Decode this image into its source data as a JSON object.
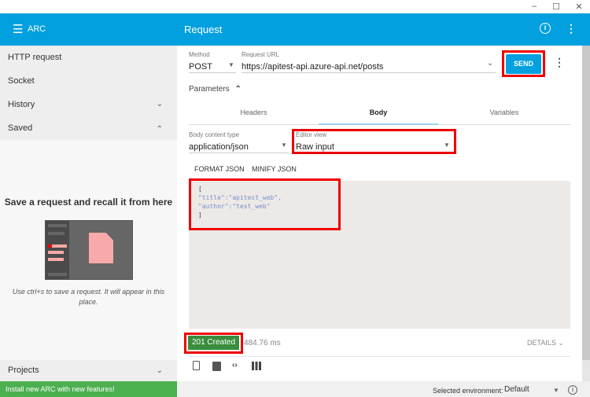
{
  "window": {
    "minimize": "–",
    "maximize": "☐",
    "close": "✕"
  },
  "header": {
    "app_name": "ARC",
    "title": "Request",
    "menu_icon": "hamburger-icon",
    "info_icon": "info-icon",
    "more_icon": "more-vert-icon"
  },
  "sidebar": {
    "items": [
      {
        "label": "HTTP request"
      },
      {
        "label": "Socket"
      },
      {
        "label": "History"
      },
      {
        "label": "Saved"
      }
    ],
    "empty_title": "Save a request and recall it from here",
    "empty_hint": "Use ctrl+s to save a request. It will appear in this place.",
    "projects": "Projects",
    "install_banner": "Install new ARC with new features!"
  },
  "request": {
    "method_label": "Method",
    "method": "POST",
    "url_label": "Request URL",
    "url": "https://apitest-api.azure-api.net/posts",
    "send": "SEND",
    "parameters": "Parameters",
    "tabs": [
      {
        "label": "Headers"
      },
      {
        "label": "Body",
        "active": true
      },
      {
        "label": "Variables"
      }
    ],
    "body_type_label": "Body content type",
    "body_type": "application/json",
    "editor_view_label": "Editor view",
    "editor_view": "Raw input",
    "format_json": "FORMAT JSON",
    "minify_json": "MINIFY JSON",
    "body_lines": [
      "[",
      "\"title\":\"apitest_web\",",
      "\"author\":\"test_web\"",
      "]"
    ]
  },
  "response": {
    "status": "201 Created",
    "status_color": "#388e3c",
    "time": "484.76 ms",
    "details": "DETAILS"
  },
  "footer": {
    "env_label": "Selected environment:",
    "env_value": "Default"
  },
  "colors": {
    "accent": "#03a0df",
    "highlight": "#ee0000",
    "banner": "#4caf50"
  }
}
